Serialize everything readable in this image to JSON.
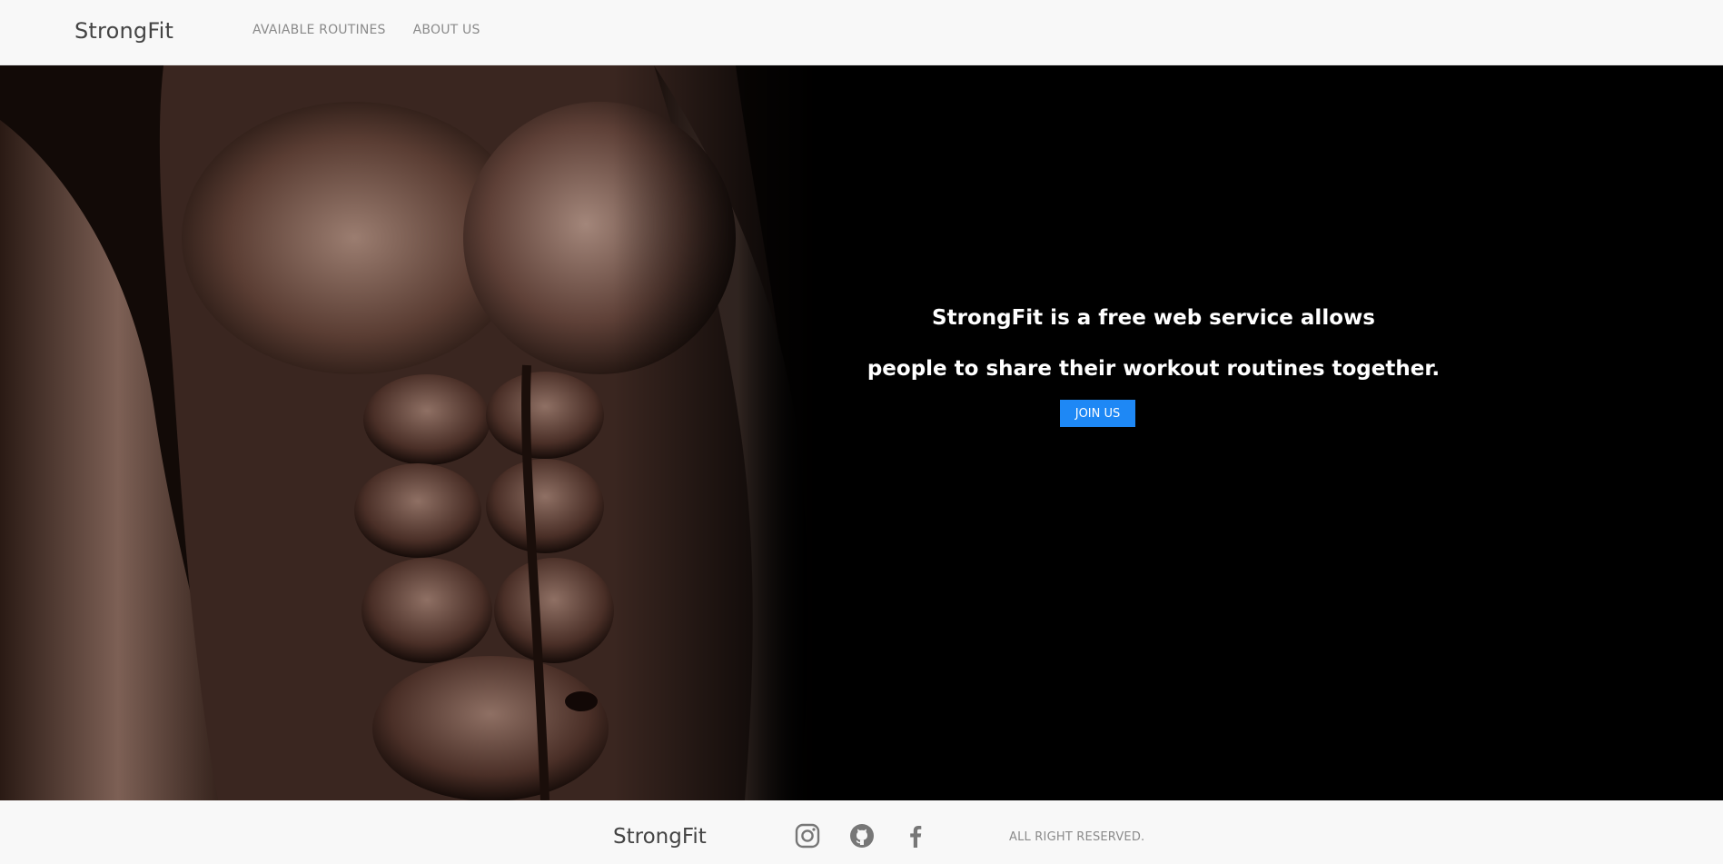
{
  "navbar": {
    "brand": "StrongFit",
    "links": [
      {
        "label": "AVAIABLE ROUTINES"
      },
      {
        "label": "ABOUT US"
      }
    ]
  },
  "hero": {
    "line1": "StrongFit is a free web service allows",
    "line2": "people to share their workout routines together.",
    "cta_label": "JOIN US",
    "cta_color": "#1e88f5",
    "background": "#000000"
  },
  "footer": {
    "brand": "StrongFit",
    "social_icons": [
      "instagram-icon",
      "github-icon",
      "facebook-icon"
    ],
    "copyright": "ALL RIGHT RESERVED."
  }
}
